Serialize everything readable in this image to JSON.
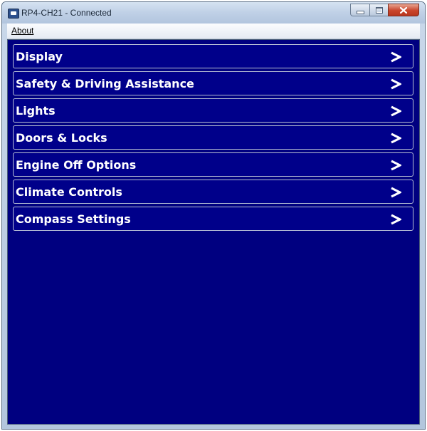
{
  "window": {
    "title": "RP4-CH21 - Connected",
    "icon": "app-icon",
    "controls": [
      "minimize-icon",
      "maximize-icon",
      "close-icon"
    ]
  },
  "menubar": {
    "about_label": "About"
  },
  "main": {
    "background_color": "#000080",
    "items": [
      {
        "label": "Display",
        "icon": "chevron-right-icon"
      },
      {
        "label": "Safety & Driving Assistance",
        "icon": "chevron-right-icon"
      },
      {
        "label": "Lights",
        "icon": "chevron-right-icon"
      },
      {
        "label": "Doors & Locks",
        "icon": "chevron-right-icon"
      },
      {
        "label": "Engine Off Options",
        "icon": "chevron-right-icon"
      },
      {
        "label": "Climate Controls",
        "icon": "chevron-right-icon"
      },
      {
        "label": "Compass Settings",
        "icon": "chevron-right-icon"
      }
    ]
  }
}
